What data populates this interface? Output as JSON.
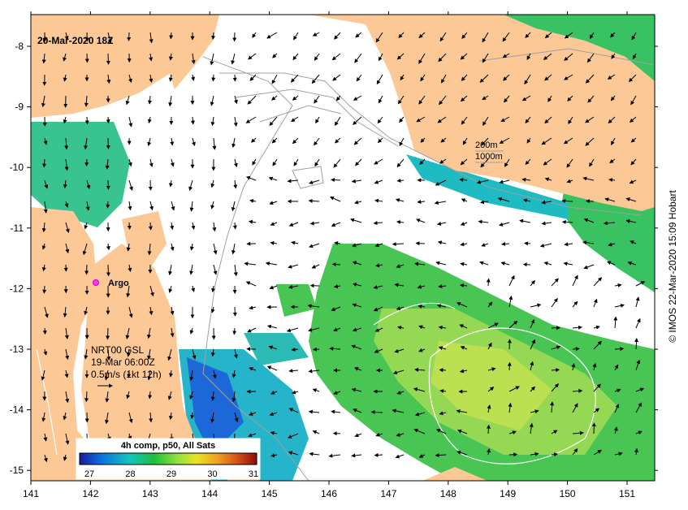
{
  "map": {
    "timestamp": "20-Mar-2020 18Z",
    "credit": "© IMOS 22-Mar-2020 15:09 Hobart",
    "argo_label": "Argo",
    "isobaths": [
      "200m",
      "1000m"
    ],
    "current_info": [
      "NRT00 GSL",
      "19-Mar 06:00Z",
      "0.5m/s (1kt 12h)"
    ],
    "colorbar": {
      "title": "4h comp, p50, All Sats",
      "ticks": [
        "27",
        "28",
        "29",
        "30",
        "31"
      ],
      "colors": [
        "#1a1a9e",
        "#0b6fe0",
        "#11c5c0",
        "#1fbf3a",
        "#8fe040",
        "#e8e420",
        "#f0a020",
        "#d44a14",
        "#8a0c0c"
      ]
    },
    "x_ticks": [
      "141",
      "142",
      "143",
      "144",
      "145",
      "146",
      "147",
      "148",
      "149",
      "150",
      "151"
    ],
    "y_ticks": [
      "-8",
      "-9",
      "-10",
      "-11",
      "-12",
      "-13",
      "-14",
      "-15"
    ],
    "colors": {
      "land": "#fbc896",
      "ocean": "#ffffff",
      "argo": "#ff33ff"
    }
  }
}
